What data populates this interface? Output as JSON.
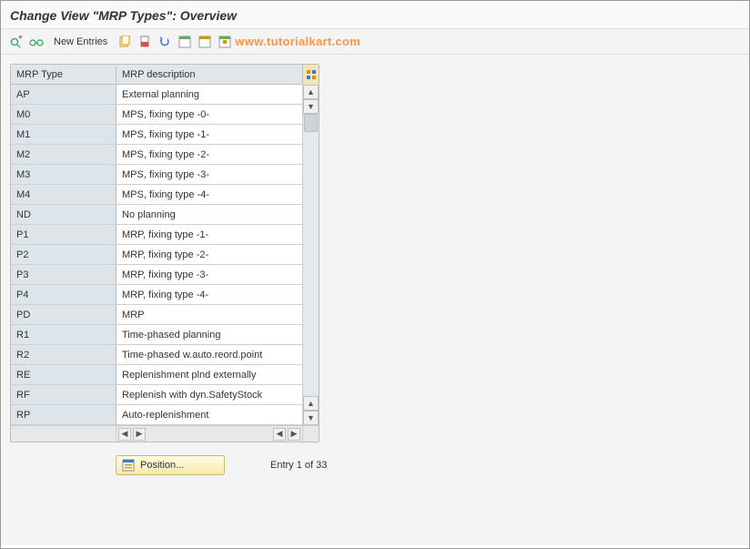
{
  "title": "Change View \"MRP Types\": Overview",
  "toolbar": {
    "new_entries_label": "New Entries",
    "watermark": "www.tutorialkart.com"
  },
  "table": {
    "header_type": "MRP Type",
    "header_desc": "MRP description",
    "rows": [
      {
        "type": "AP",
        "desc": "External planning"
      },
      {
        "type": "M0",
        "desc": "MPS, fixing type -0-"
      },
      {
        "type": "M1",
        "desc": "MPS, fixing type -1-"
      },
      {
        "type": "M2",
        "desc": "MPS, fixing type -2-"
      },
      {
        "type": "M3",
        "desc": "MPS, fixing type  -3-"
      },
      {
        "type": "M4",
        "desc": "MPS, fixing type -4-"
      },
      {
        "type": "ND",
        "desc": "No planning"
      },
      {
        "type": "P1",
        "desc": "MRP, fixing type -1-"
      },
      {
        "type": "P2",
        "desc": "MRP, fixing type -2-"
      },
      {
        "type": "P3",
        "desc": "MRP, fixing type -3-"
      },
      {
        "type": "P4",
        "desc": "MRP, fixing type -4-"
      },
      {
        "type": "PD",
        "desc": "MRP"
      },
      {
        "type": "R1",
        "desc": "Time-phased planning"
      },
      {
        "type": "R2",
        "desc": "Time-phased w.auto.reord.point"
      },
      {
        "type": "RE",
        "desc": "Replenishment plnd externally"
      },
      {
        "type": "RF",
        "desc": "Replenish with dyn.SafetyStock"
      },
      {
        "type": "RP",
        "desc": "Auto-replenishment"
      }
    ]
  },
  "footer": {
    "position_label": "Position...",
    "entry_status": "Entry 1 of 33"
  }
}
